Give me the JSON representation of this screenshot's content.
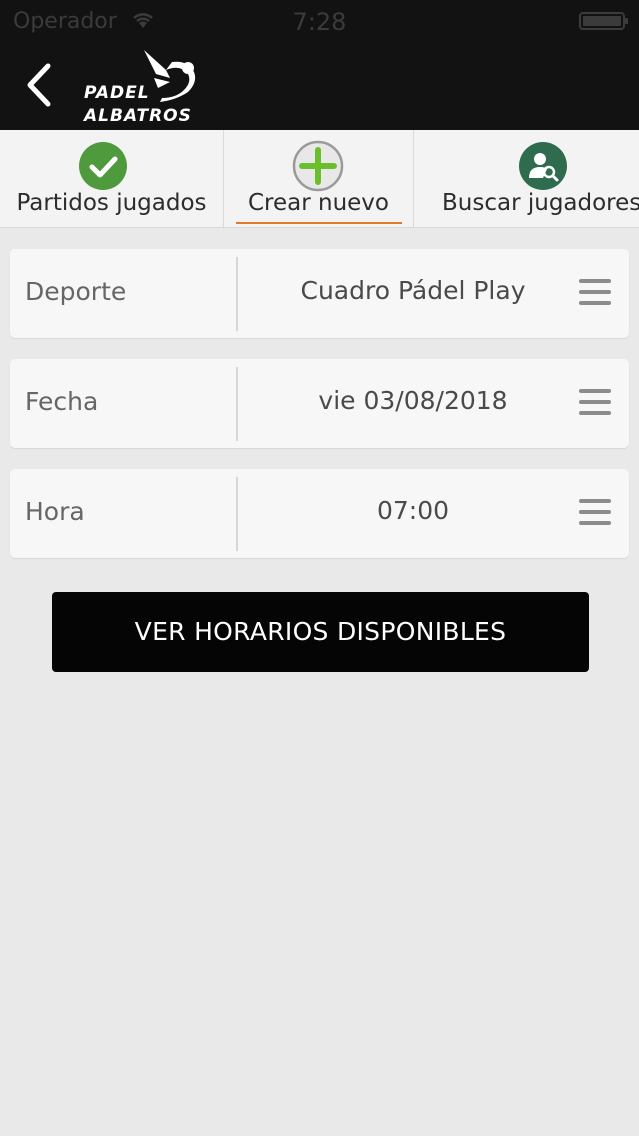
{
  "status_bar": {
    "carrier": "Operador",
    "time": "7:28"
  },
  "nav": {
    "logo_line1": "PADEL",
    "logo_line2": "ALBATROS"
  },
  "tabs": [
    {
      "label": "Partidos jugados",
      "icon": "check-icon",
      "color": "#4f9a3d",
      "selected": false
    },
    {
      "label": "Crear nuevo",
      "icon": "plus-icon",
      "color": "#6cbf2c",
      "selected": true
    },
    {
      "label": "Buscar jugadores",
      "icon": "search-user-icon",
      "color": "#2f6b4f",
      "selected": false
    }
  ],
  "form": {
    "deporte": {
      "label": "Deporte",
      "value": "Cuadro Pádel Play"
    },
    "fecha": {
      "label": "Fecha",
      "value": "vie 03/08/2018"
    },
    "hora": {
      "label": "Hora",
      "value": "07:00"
    }
  },
  "button": {
    "label": "VER HORARIOS DISPONIBLES"
  },
  "colors": {
    "accent_underline": "#e07a2e",
    "bar_background": "#121212"
  }
}
